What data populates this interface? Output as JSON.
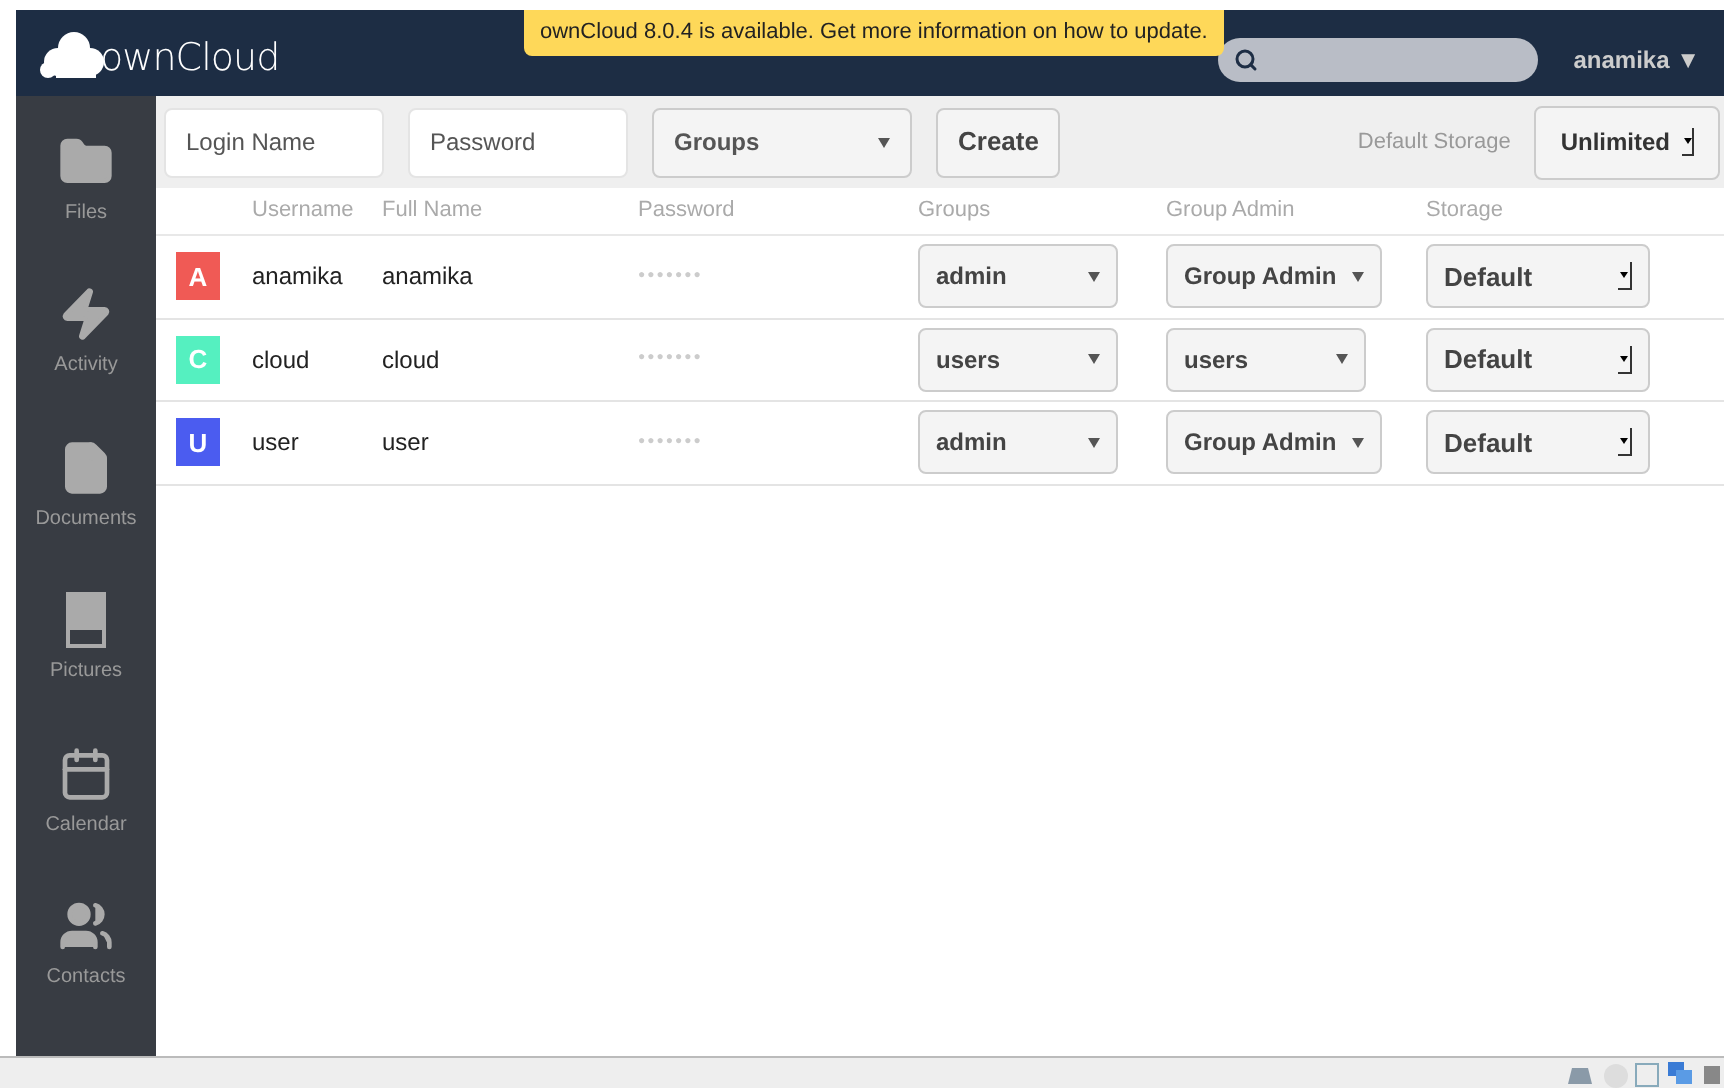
{
  "header": {
    "logo": "ownCloud",
    "notification": "ownCloud 8.0.4 is available. Get more information on how to update.",
    "user_menu": "anamika ▼"
  },
  "sidebar": {
    "items": [
      {
        "kind": "folder",
        "label": "Files",
        "selected": false
      },
      {
        "kind": "bolt",
        "label": "Activity",
        "selected": false
      },
      {
        "kind": "document",
        "label": "Documents",
        "selected": false
      },
      {
        "kind": "picture",
        "label": "Pictures",
        "selected": false
      },
      {
        "kind": "calendar",
        "label": "Calendar",
        "selected": false
      },
      {
        "kind": "contacts",
        "label": "Contacts",
        "selected": false
      }
    ]
  },
  "new_user": {
    "login_placeholder": "Login Name",
    "password_placeholder": "Password",
    "groups": "Groups",
    "create": "Create",
    "default_storage_label": "Default Storage",
    "default_storage": "Unlimited"
  },
  "table": {
    "columns": [
      "Username",
      "Full Name",
      "Password",
      "Groups",
      "Group Admin",
      "Storage"
    ],
    "rows": [
      {
        "initial": "A",
        "color": "#f05a55",
        "username": "anamika",
        "full_name": "anamika",
        "password": "●●●●●●●",
        "groups": "admin",
        "group_admin": "Group Admin",
        "storage": "Default"
      },
      {
        "initial": "C",
        "color": "#55f0c0",
        "username": "cloud",
        "full_name": "cloud",
        "password": "●●●●●●●",
        "groups": "users",
        "group_admin": "users",
        "storage": "Default"
      },
      {
        "initial": "U",
        "color": "#4b5cf0",
        "username": "user",
        "full_name": "user",
        "password": "●●●●●●●",
        "groups": "admin",
        "group_admin": "Group Admin",
        "storage": "Default"
      }
    ]
  }
}
